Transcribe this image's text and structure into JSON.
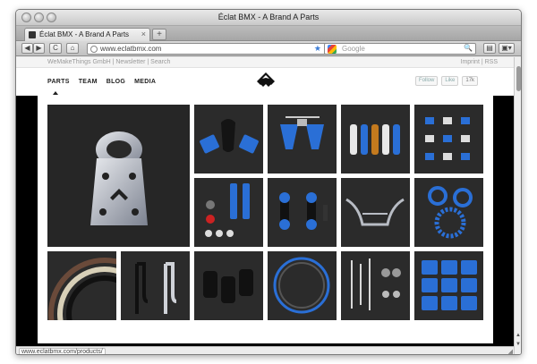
{
  "window": {
    "title": "Éclat BMX - A Brand A Parts"
  },
  "tabs": [
    {
      "label": "Éclat BMX - A Brand A Parts",
      "close": "×"
    }
  ],
  "new_tab_glyph": "+",
  "toolbar": {
    "back_glyph": "◀",
    "forward_glyph": "▶",
    "reload_glyph": "C",
    "home_glyph": "⌂",
    "url": "www.eclatbmx.com",
    "bookmark_glyph": "★",
    "dropdown_glyph": "▾",
    "search_placeholder": "Google",
    "search_glyph": "🔍"
  },
  "site": {
    "top_left": "WeMakeThings GmbH | Newsletter | Search",
    "top_right": "Imprint | RSS",
    "nav": [
      "PARTS",
      "TEAM",
      "BLOG",
      "MEDIA"
    ],
    "active_nav": "PARTS",
    "social": {
      "follow": "Follow",
      "like": "Like",
      "count": "17k"
    }
  },
  "products": [
    {
      "icon": "stem-icon"
    },
    {
      "icon": "seat-and-pedals-icon"
    },
    {
      "icon": "brake-icon"
    },
    {
      "icon": "grips-icon"
    },
    {
      "icon": "small-parts-icon"
    },
    {
      "icon": "pegs-and-bolts-icon"
    },
    {
      "icon": "hubs-icon"
    },
    {
      "icon": "handlebars-icon"
    },
    {
      "icon": "sprockets-icon"
    },
    {
      "icon": "tires-icon"
    },
    {
      "icon": "forks-icon"
    },
    {
      "icon": "pegs-icon"
    },
    {
      "icon": "rim-icon"
    },
    {
      "icon": "tools-icon"
    },
    {
      "icon": "pedals-icon"
    }
  ],
  "status_url": "www.eclatbmx.com/products/",
  "colors": {
    "accent_blue": "#2a6fd6",
    "tile_bg": "#2b2b2b"
  }
}
